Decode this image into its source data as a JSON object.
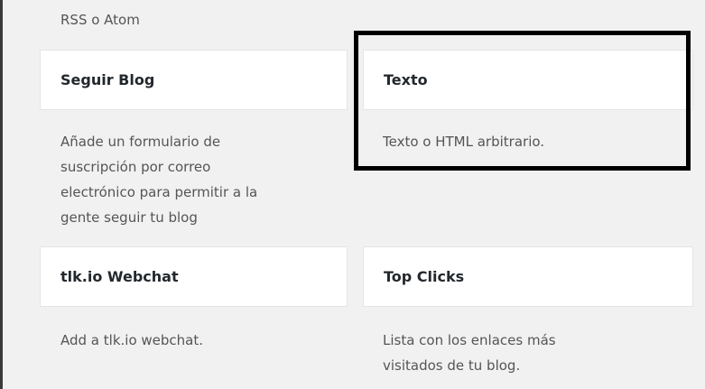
{
  "top_description": "RSS o Atom",
  "widgets": [
    {
      "title": "Seguir Blog",
      "description": "Añade un formulario de\nsuscripción por correo\nelectrónico para permitir a la\ngente seguir tu blog"
    },
    {
      "title": "Texto",
      "description": "Texto o HTML arbitrario."
    },
    {
      "title": "tlk.io Webchat",
      "description": "Add a tlk.io webchat."
    },
    {
      "title": "Top Clicks",
      "description": "Lista con los enlaces más\nvisitados de tu blog."
    }
  ],
  "colors": {
    "page_background": "#f1f1f1",
    "card_background": "#ffffff",
    "highlight_border": "#000000"
  }
}
